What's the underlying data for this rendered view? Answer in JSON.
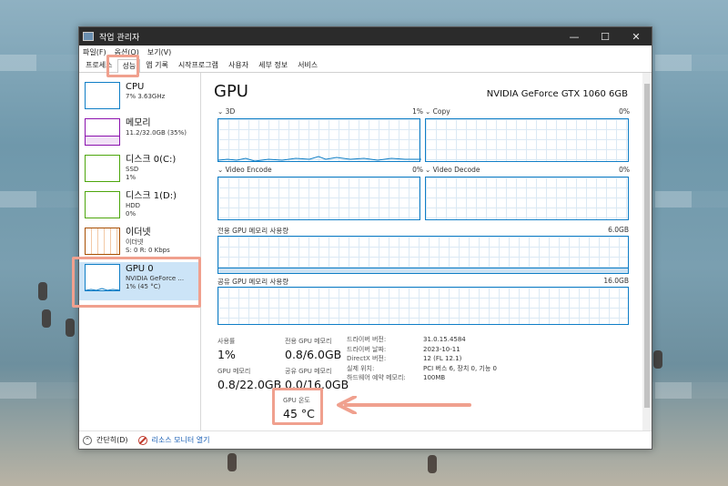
{
  "window": {
    "title": "작업 관리자",
    "min_glyph": "—",
    "max_glyph": "☐",
    "close_glyph": "✕"
  },
  "menu": [
    "파일(F)",
    "옵션(O)",
    "보기(V)"
  ],
  "tabs": [
    "프로세스",
    "성능",
    "앱 기록",
    "시작프로그램",
    "사용자",
    "세부 정보",
    "서비스"
  ],
  "sidebar": [
    {
      "name": "CPU",
      "line1": "7% 3.63GHz",
      "line2": "",
      "color": "#0f7ec6"
    },
    {
      "name": "메모리",
      "line1": "11.2/32.0GB (35%)",
      "line2": "",
      "color": "#8b12ae"
    },
    {
      "name": "디스크 0(C:)",
      "line1": "SSD",
      "line2": "1%",
      "color": "#4da60c"
    },
    {
      "name": "디스크 1(D:)",
      "line1": "HDD",
      "line2": "0%",
      "color": "#4da60c"
    },
    {
      "name": "이더넷",
      "line1": "이더넷",
      "line2": "S: 0 R: 0 Kbps",
      "color": "#a74f01"
    },
    {
      "name": "GPU 0",
      "line1": "NVIDIA GeForce ...",
      "line2": "1% (45 °C)",
      "color": "#0f7ec6"
    }
  ],
  "main": {
    "title": "GPU",
    "model": "NVIDIA GeForce GTX 1060 6GB",
    "engines": [
      {
        "label": "3D",
        "pct": "1%"
      },
      {
        "label": "Copy",
        "pct": "0%"
      },
      {
        "label": "Video Encode",
        "pct": "0%"
      },
      {
        "label": "Video Decode",
        "pct": "0%"
      }
    ],
    "dedicated_graph": {
      "label": "전용 GPU 메모리 사용량",
      "max": "6.0GB"
    },
    "shared_graph": {
      "label": "공유 GPU 메모리 사용량",
      "max": "16.0GB"
    },
    "stats": {
      "usage_label": "사용률",
      "usage_value": "1%",
      "ded_label": "전용 GPU 메모리",
      "ded_value": "0.8/6.0GB",
      "gpumem_label": "GPU 메모리",
      "gpumem_value": "0.8/22.0GB",
      "shared_label": "공유 GPU 메모리",
      "shared_value": "0.0/16.0GB",
      "temp_label": "GPU 온도",
      "temp_value": "45 °C"
    },
    "info": [
      {
        "k": "드라이버 버전:",
        "v": "31.0.15.4584"
      },
      {
        "k": "드라이버 날짜:",
        "v": "2023-10-11"
      },
      {
        "k": "DirectX 버전:",
        "v": "12 (FL 12.1)"
      },
      {
        "k": "실제 위치:",
        "v": "PCI 버스 6, 장치 0, 기능 0"
      },
      {
        "k": "하드웨어 예약 메모리:",
        "v": "100MB"
      }
    ]
  },
  "footer": {
    "collapse": "간단히(D)",
    "resource_monitor": "리소스 모니터 열기"
  },
  "accent": "#f0a08e"
}
